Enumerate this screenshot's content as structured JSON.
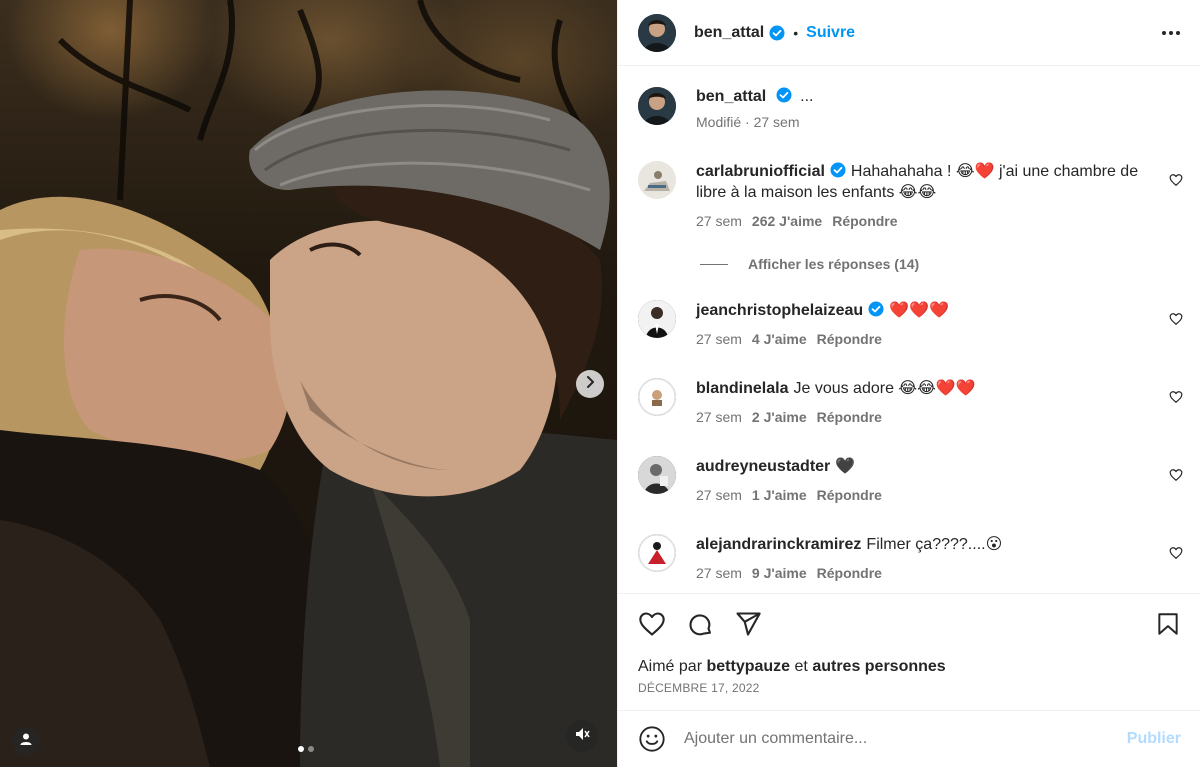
{
  "post": {
    "author": "ben_attal",
    "follow_label": "Suivre",
    "separator": "•",
    "caption_ellipsis": "...",
    "caption_meta": "Modifié · 27 sem"
  },
  "comments": [
    {
      "user": "carlabruniofficial",
      "verified": true,
      "text": "Hahahahaha ! 😂❤️ j'ai une chambre de libre à la maison les enfants 😂😂",
      "time": "27 sem",
      "likes": "262 J'aime",
      "reply": "Répondre"
    },
    {
      "user": "jeanchristophelaizeau",
      "verified": true,
      "text": "❤️❤️❤️",
      "time": "27 sem",
      "likes": "4 J'aime",
      "reply": "Répondre"
    },
    {
      "user": "blandinelala",
      "verified": false,
      "text": "Je vous adore 😂😂❤️❤️",
      "time": "27 sem",
      "likes": "2 J'aime",
      "reply": "Répondre"
    },
    {
      "user": "audreyneustadter",
      "verified": false,
      "text": "🖤",
      "time": "27 sem",
      "likes": "1 J'aime",
      "reply": "Répondre"
    },
    {
      "user": "alejandrarinckramirez",
      "verified": false,
      "text": "Filmer ça????....😮",
      "time": "27 sem",
      "likes": "9 J'aime",
      "reply": "Répondre"
    }
  ],
  "view_replies": "Afficher les réponses (14)",
  "likes_line": {
    "prefix": "Aimé par",
    "user": "bettypauze",
    "middle": "et",
    "others": "autres personnes"
  },
  "date": "DÉCEMBRE 17, 2022",
  "add_comment": {
    "placeholder": "Ajouter un commentaire...",
    "publish": "Publier"
  },
  "icons": {
    "verified": "verified-badge-icon",
    "more": "more-options-icon",
    "like": "heart-icon",
    "comment": "comment-bubble-icon",
    "share": "paper-plane-icon",
    "save": "bookmark-icon",
    "emoji": "smiley-icon",
    "next": "chevron-right-icon",
    "mute": "speaker-muted-icon",
    "tags": "user-tag-icon"
  },
  "colors": {
    "accent": "#0095f6",
    "verified": "#0095f6",
    "text": "#262626",
    "secondary": "#737373",
    "publish_disabled": "#b3dbff"
  },
  "carousel": {
    "count": 2,
    "active": 0
  }
}
